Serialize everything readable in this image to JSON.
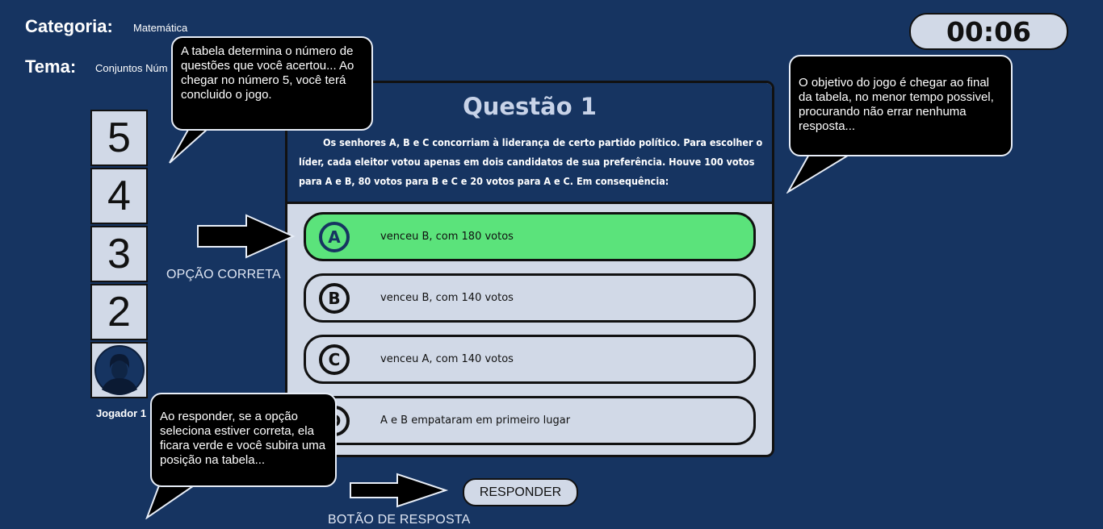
{
  "header": {
    "category_label": "Categoria:",
    "category_value": "Matemática",
    "theme_label": "Tema:",
    "theme_value": "Conjuntos Núm"
  },
  "timer": "00:06",
  "ranking": {
    "levels": [
      "5",
      "4",
      "3",
      "2"
    ],
    "player_name": "Jogador 1"
  },
  "question": {
    "title": "Questão 1",
    "text": "Os senhores A, B e C concorriam à liderança de certo partido político. Para escolher o líder, cada eleitor votou apenas em dois candidatos de sua preferência. Houve 100 votos para A e B, 80 votos para B e C e 20 votos para A e C. Em consequência:",
    "options": [
      {
        "letter": "A",
        "text": "venceu B, com 180 votos",
        "correct": true
      },
      {
        "letter": "B",
        "text": "venceu B, com 140 votos"
      },
      {
        "letter": "C",
        "text": "venceu A, com 140 votos"
      },
      {
        "letter": "D",
        "text": "A e B empataram em primeiro lugar"
      }
    ]
  },
  "tips": {
    "table": "A tabela determina o número de questões que você acertou... Ao chegar no número 5, você terá concluido o jogo.",
    "objective": "O objetivo do jogo é chegar ao final da tabela, no menor tempo possivel, procurando não errar nenhuma resposta...",
    "answer": "Ao responder, se a opção seleciona estiver correta, ela ficara verde e você subira uma posição na tabela...",
    "correct_option_label": "OPÇÃO CORRETA",
    "answer_button_label": "BOTÃO DE RESPOSTA"
  },
  "respond_button": "RESPONDER",
  "colors": {
    "background": "#163461",
    "panel": "#d1d9e7",
    "correct": "#5be37b",
    "bubble": "#000000"
  }
}
